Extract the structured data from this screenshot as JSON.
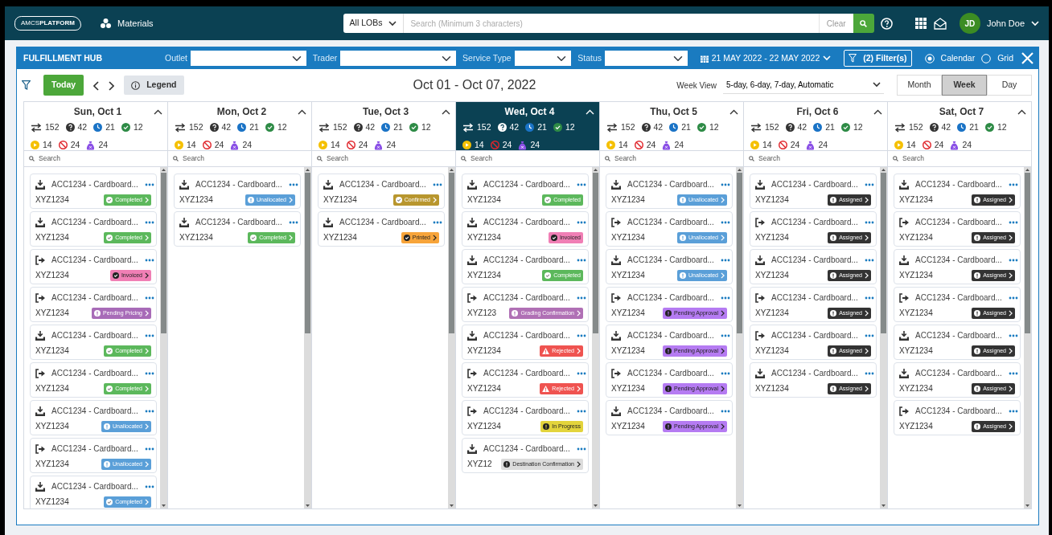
{
  "nav": {
    "logo": "AMCS**PLATFORM**",
    "module": "Materials",
    "lob": "All LOBs",
    "search": {
      "placeholder": "Search (Minimum 3 characters)"
    },
    "clear": "Clear",
    "user": {
      "initials": "JD",
      "name": "John Doe"
    }
  },
  "hub": {
    "title": "FULFILLMENT HUB",
    "filters": [
      {
        "label": "Outlet"
      },
      {
        "label": "Trader"
      },
      {
        "label": "Service Type"
      },
      {
        "label": "Status"
      }
    ],
    "date_range": "21 MAY 2022 - 22 MAY 2022",
    "filter_button": "(2) Filter(s)",
    "views": [
      {
        "label": "Calendar",
        "selected": true
      },
      {
        "label": "Grid",
        "selected": false
      }
    ]
  },
  "toolbar": {
    "today": "Today",
    "legend": "Legend",
    "range_title": "Oct 01 - Oct 07, 2022",
    "week_view_label": "Week View",
    "week_view": "5-day, 6-day, 7-day, Automatic",
    "modes": [
      {
        "label": "Month",
        "selected": false
      },
      {
        "label": "Week",
        "selected": true
      },
      {
        "label": "Day",
        "selected": false
      }
    ]
  },
  "days": [
    {
      "label": "Sun, Oct 1",
      "selected": false,
      "counts": [
        {
          "kind": "transfer",
          "value": "152"
        },
        {
          "kind": "unknown",
          "value": "42"
        },
        {
          "kind": "waiting",
          "value": "21"
        },
        {
          "kind": "done",
          "value": "12"
        },
        {
          "kind": "active",
          "value": "14"
        },
        {
          "kind": "blocked",
          "value": "24"
        },
        {
          "kind": "bag",
          "value": "24"
        }
      ],
      "search": {
        "placeholder": "Search"
      },
      "cards": [
        {
          "kind": "inbound",
          "title": "ACC1234 - Cardboard...",
          "ref": "XYZ1234",
          "status": {
            "label": "Completed",
            "kind": "done",
            "color": "#5cb85c",
            "chevron": true
          }
        },
        {
          "kind": "inbound",
          "title": "ACC1234 - Cardboard...",
          "ref": "XYZ1234",
          "status": {
            "label": "Completed",
            "kind": "done",
            "color": "#5cb85c",
            "chevron": true
          }
        },
        {
          "kind": "outbound",
          "title": "ACC1234 - Cardboard...",
          "ref": "XYZ1234",
          "status": {
            "label": "Invoiced",
            "kind": "done",
            "color": "#f07fb5",
            "chevron": true
          }
        },
        {
          "kind": "outbound",
          "title": "ACC1234 - Cardboard...",
          "ref": "XYZ1234",
          "status": {
            "label": "Pending Pricing",
            "kind": "info",
            "color": "#a86bb8",
            "chevron": true
          }
        },
        {
          "kind": "inbound",
          "title": "ACC1234 - Cardboard...",
          "ref": "XYZ1234",
          "status": {
            "label": "Completed",
            "kind": "done",
            "color": "#5cb85c",
            "chevron": true
          }
        },
        {
          "kind": "outbound",
          "title": "ACC1234 - Cardboard...",
          "ref": "XYZ1234",
          "status": {
            "label": "Completed",
            "kind": "done",
            "color": "#5cb85c",
            "chevron": true
          }
        },
        {
          "kind": "inbound",
          "title": "ACC1234 - Cardboard...",
          "ref": "XYZ1234",
          "status": {
            "label": "Unallocated",
            "kind": "info",
            "color": "#5a9fd8",
            "chevron": true
          }
        },
        {
          "kind": "outbound",
          "title": "ACC1234 - Cardboard...",
          "ref": "XYZ1234",
          "status": {
            "label": "Unallocated",
            "kind": "info",
            "color": "#5a9fd8",
            "chevron": true
          }
        },
        {
          "kind": "inbound",
          "title": "ACC1234 - Cardboard...",
          "ref": "XYZ1234",
          "status": {
            "label": "Completed",
            "kind": "done",
            "color": "#5a9fd8",
            "chevron": true
          }
        }
      ]
    },
    {
      "label": "Mon, Oct 2",
      "selected": false,
      "counts": [
        {
          "kind": "transfer",
          "value": "152"
        },
        {
          "kind": "unknown",
          "value": "42"
        },
        {
          "kind": "waiting",
          "value": "21"
        },
        {
          "kind": "done",
          "value": "12"
        },
        {
          "kind": "active",
          "value": "14"
        },
        {
          "kind": "blocked",
          "value": "24"
        },
        {
          "kind": "bag",
          "value": "24"
        }
      ],
      "search": {
        "placeholder": "Search"
      },
      "cards": [
        {
          "kind": "inbound",
          "title": "ACC1234 - Cardboard...",
          "ref": "XYZ1234",
          "status": {
            "label": "Unallocated",
            "kind": "info",
            "color": "#5a9fd8",
            "chevron": true
          }
        },
        {
          "kind": "inbound",
          "title": "ACC1234 - Cardboard...",
          "ref": "XYZ1234",
          "status": {
            "label": "Completed",
            "kind": "done",
            "color": "#5cb85c",
            "chevron": true
          }
        }
      ]
    },
    {
      "label": "Tue, Oct 3",
      "selected": false,
      "counts": [
        {
          "kind": "transfer",
          "value": "152"
        },
        {
          "kind": "unknown",
          "value": "42"
        },
        {
          "kind": "waiting",
          "value": "21"
        },
        {
          "kind": "done",
          "value": "12"
        },
        {
          "kind": "active",
          "value": "14"
        },
        {
          "kind": "blocked",
          "value": "24"
        },
        {
          "kind": "bag",
          "value": "24"
        }
      ],
      "search": {
        "placeholder": "Search"
      },
      "cards": [
        {
          "kind": "inbound",
          "title": "ACC1234 - Cardboard...",
          "ref": "XYZ1234",
          "status": {
            "label": "Confirmed",
            "kind": "done",
            "color": "#b8962e",
            "chevron": true
          }
        },
        {
          "kind": "inbound",
          "title": "ACC1234 - Cardboard...",
          "ref": "XYZ1234",
          "status": {
            "label": "Printed",
            "kind": "done",
            "color": "#f7a43a",
            "chevron": true
          }
        }
      ]
    },
    {
      "label": "Wed, Oct 4",
      "selected": true,
      "counts": [
        {
          "kind": "transfer",
          "value": "152"
        },
        {
          "kind": "unknown",
          "value": "42"
        },
        {
          "kind": "waiting",
          "value": "21"
        },
        {
          "kind": "done",
          "value": "12"
        },
        {
          "kind": "active",
          "value": "14"
        },
        {
          "kind": "blocked",
          "value": "24"
        },
        {
          "kind": "bag",
          "value": "24"
        }
      ],
      "search": {
        "placeholder": "Search"
      },
      "cards": [
        {
          "kind": "inbound",
          "title": "ACC1234 - Cardboard...",
          "ref": "XYZ1234",
          "status": {
            "label": "Completed",
            "kind": "done",
            "color": "#5cb85c",
            "chevron": false
          }
        },
        {
          "kind": "inbound",
          "title": "ACC1234 - Cardboard...",
          "ref": "XYZ1234",
          "status": {
            "label": "Invoiced",
            "kind": "done",
            "color": "#f07fb5",
            "chevron": false
          }
        },
        {
          "kind": "inbound",
          "title": "ACC1234 - Cardboard...",
          "ref": "XYZ1234",
          "status": {
            "label": "Completed",
            "kind": "done",
            "color": "#5cb85c",
            "chevron": false
          }
        },
        {
          "kind": "outbound",
          "title": "ACC1234 - Cardboard...",
          "ref": "XYZ123",
          "status": {
            "label": "Grading Confirmation",
            "kind": "info",
            "color": "#b070b5",
            "chevron": true
          }
        },
        {
          "kind": "inbound",
          "title": "ACC1234 - Cardboard...",
          "ref": "XYZ1234",
          "status": {
            "label": "Rejected",
            "kind": "alert",
            "color": "#ef5350",
            "chevron": true
          }
        },
        {
          "kind": "outbound",
          "title": "ACC1234 - Cardboard...",
          "ref": "XYZ1234",
          "status": {
            "label": "Rejected",
            "kind": "alert",
            "color": "#ef5350",
            "chevron": true
          }
        },
        {
          "kind": "outbound",
          "title": "ACC1234 - Cardboard...",
          "ref": "XYZ1234",
          "status": {
            "label": "In Progress",
            "kind": "info",
            "color": "#e3d43c",
            "chevron": false
          }
        },
        {
          "kind": "inbound",
          "title": "ACC1234 - Cardboard...",
          "ref": "XYZ12",
          "status": {
            "label": "Destination Confirmation",
            "kind": "info",
            "color": "#dcdcdc",
            "chevron": true
          }
        }
      ]
    },
    {
      "label": "Thu, Oct 5",
      "selected": false,
      "counts": [
        {
          "kind": "transfer",
          "value": "152"
        },
        {
          "kind": "unknown",
          "value": "42"
        },
        {
          "kind": "waiting",
          "value": "21"
        },
        {
          "kind": "done",
          "value": "12"
        },
        {
          "kind": "active",
          "value": "14"
        },
        {
          "kind": "blocked",
          "value": "24"
        },
        {
          "kind": "bag",
          "value": "24"
        }
      ],
      "search": {
        "placeholder": "Search"
      },
      "cards": [
        {
          "kind": "inbound",
          "title": "ACC1234 - Cardboard...",
          "ref": "XYZ1234",
          "status": {
            "label": "Unallocated",
            "kind": "info",
            "color": "#5a9fd8",
            "chevron": true
          }
        },
        {
          "kind": "outbound",
          "title": "ACC1234 - Cardboard...",
          "ref": "XYZ1234",
          "status": {
            "label": "Unallocated",
            "kind": "info",
            "color": "#5a9fd8",
            "chevron": true
          }
        },
        {
          "kind": "inbound",
          "title": "ACC1234 - Cardboard...",
          "ref": "XYZ1234",
          "status": {
            "label": "Unallocated",
            "kind": "info",
            "color": "#5a9fd8",
            "chevron": true
          }
        },
        {
          "kind": "outbound",
          "title": "ACC1234 - Cardboard...",
          "ref": "XYZ1234",
          "status": {
            "label": "Pending Approval",
            "kind": "info",
            "color": "#b57bf2",
            "chevron": true
          }
        },
        {
          "kind": "inbound",
          "title": "ACC1234 - Cardboard...",
          "ref": "XYZ1234",
          "status": {
            "label": "Pending Approval",
            "kind": "info",
            "color": "#b57bf2",
            "chevron": true
          }
        },
        {
          "kind": "outbound",
          "title": "ACC1234 - Cardboard...",
          "ref": "XYZ1234",
          "status": {
            "label": "Pending Approval",
            "kind": "info",
            "color": "#b57bf2",
            "chevron": true
          }
        },
        {
          "kind": "inbound",
          "title": "ACC1234 - Cardboard...",
          "ref": "XYZ1234",
          "status": {
            "label": "Pending Approval",
            "kind": "info",
            "color": "#b57bf2",
            "chevron": true
          }
        }
      ]
    },
    {
      "label": "Fri, Oct 6",
      "selected": false,
      "counts": [
        {
          "kind": "transfer",
          "value": "152"
        },
        {
          "kind": "unknown",
          "value": "42"
        },
        {
          "kind": "waiting",
          "value": "21"
        },
        {
          "kind": "done",
          "value": "12"
        },
        {
          "kind": "active",
          "value": "14"
        },
        {
          "kind": "blocked",
          "value": "24"
        },
        {
          "kind": "bag",
          "value": "24"
        }
      ],
      "search": {
        "placeholder": "Search"
      },
      "cards": [
        {
          "kind": "inbound",
          "title": "ACC1234 - Cardboard...",
          "ref": "XYZ1234",
          "status": {
            "label": "Assigned",
            "kind": "info",
            "color": "#333333",
            "chevron": true
          }
        },
        {
          "kind": "outbound",
          "title": "ACC1234 - Cardboard...",
          "ref": "XYZ1234",
          "status": {
            "label": "Assigned",
            "kind": "info",
            "color": "#333333",
            "chevron": true
          }
        },
        {
          "kind": "inbound",
          "title": "ACC1234 - Cardboard...",
          "ref": "XYZ1234",
          "status": {
            "label": "Assigned",
            "kind": "info",
            "color": "#333333",
            "chevron": true
          }
        },
        {
          "kind": "outbound",
          "title": "ACC1234 - Cardboard...",
          "ref": "XYZ1234",
          "status": {
            "label": "Assigned",
            "kind": "info",
            "color": "#333333",
            "chevron": true
          }
        },
        {
          "kind": "outbound",
          "title": "ACC1234 - Cardboard...",
          "ref": "XYZ1234",
          "status": {
            "label": "Assigned",
            "kind": "info",
            "color": "#333333",
            "chevron": true
          }
        },
        {
          "kind": "inbound",
          "title": "ACC1234 - Cardboard...",
          "ref": "XYZ1234",
          "status": {
            "label": "Assigned",
            "kind": "info",
            "color": "#333333",
            "chevron": true
          }
        }
      ]
    },
    {
      "label": "Sat, Oct 7",
      "selected": false,
      "counts": [
        {
          "kind": "transfer",
          "value": "152"
        },
        {
          "kind": "unknown",
          "value": "42"
        },
        {
          "kind": "waiting",
          "value": "21"
        },
        {
          "kind": "done",
          "value": "12"
        },
        {
          "kind": "active",
          "value": "14"
        },
        {
          "kind": "blocked",
          "value": "24"
        },
        {
          "kind": "bag",
          "value": "24"
        }
      ],
      "search": {
        "placeholder": "Search"
      },
      "cards": [
        {
          "kind": "inbound",
          "title": "ACC1234 - Cardboard...",
          "ref": "XYZ1234",
          "status": {
            "label": "Assigned",
            "kind": "info",
            "color": "#333333",
            "chevron": true
          }
        },
        {
          "kind": "outbound",
          "title": "ACC1234 - Cardboard...",
          "ref": "XYZ1234",
          "status": {
            "label": "Assigned",
            "kind": "info",
            "color": "#333333",
            "chevron": true
          }
        },
        {
          "kind": "inbound",
          "title": "ACC1234 - Cardboard...",
          "ref": "XYZ1234",
          "status": {
            "label": "Assigned",
            "kind": "info",
            "color": "#333333",
            "chevron": true
          }
        },
        {
          "kind": "outbound",
          "title": "ACC1234 - Cardboard...",
          "ref": "XYZ1234",
          "status": {
            "label": "Assigned",
            "kind": "info",
            "color": "#333333",
            "chevron": true
          }
        },
        {
          "kind": "inbound",
          "title": "ACC1234 - Cardboard...",
          "ref": "XYZ1234",
          "status": {
            "label": "Assigned",
            "kind": "info",
            "color": "#333333",
            "chevron": true
          }
        },
        {
          "kind": "inbound",
          "title": "ACC1234 - Cardboard...",
          "ref": "XYZ1234",
          "status": {
            "label": "Assigned",
            "kind": "info",
            "color": "#333333",
            "chevron": true
          }
        },
        {
          "kind": "outbound",
          "title": "ACC1234 - Cardboard...",
          "ref": "XYZ1234",
          "status": {
            "label": "Assigned",
            "kind": "info",
            "color": "#333333",
            "chevron": true
          }
        }
      ]
    }
  ]
}
